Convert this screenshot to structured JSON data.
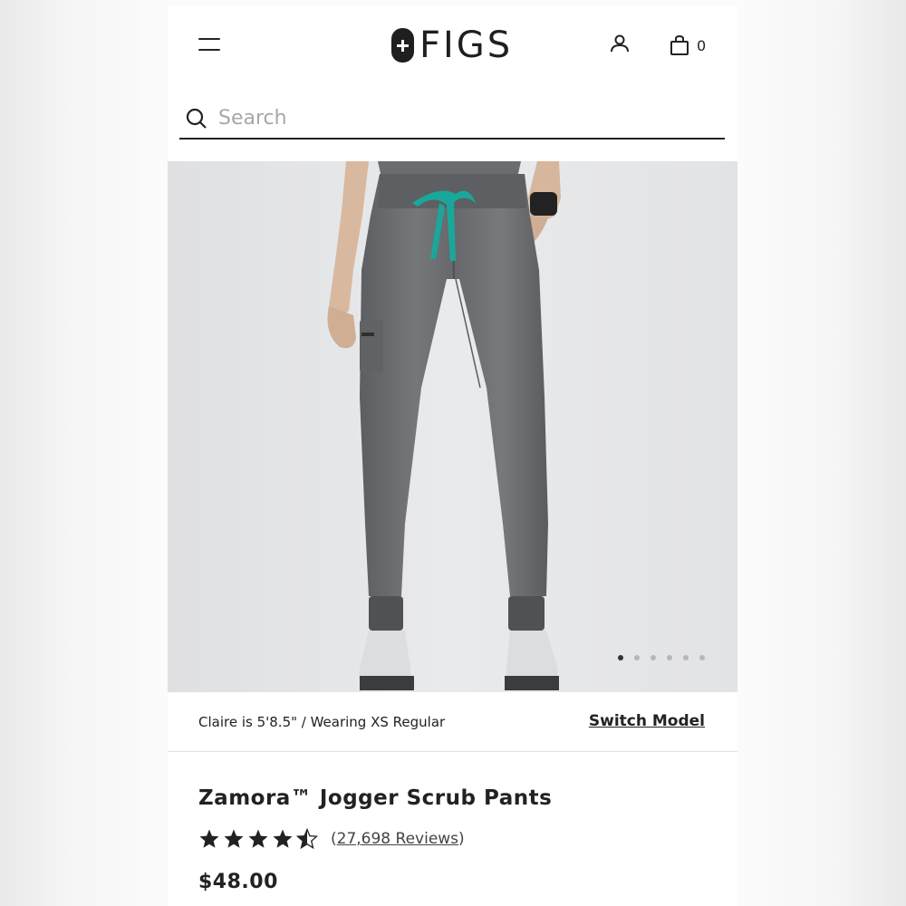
{
  "header": {
    "logo_text": "FIGS",
    "cart_count": "0"
  },
  "search": {
    "placeholder": "Search"
  },
  "gallery": {
    "slide_count": 6,
    "active_slide": 1
  },
  "model_info": {
    "text": "Claire is 5'8.5\" / Wearing XS Regular",
    "switch_label": "Switch Model"
  },
  "product": {
    "title": "Zamora™ Jogger Scrub Pants",
    "rating": 4.5,
    "reviews_open": "(",
    "reviews_count": "27,698 Reviews",
    "reviews_close": ")",
    "price": "$48.00"
  },
  "colors": {
    "drawstring": "#1aa79b",
    "pants": "#6b6d70"
  }
}
